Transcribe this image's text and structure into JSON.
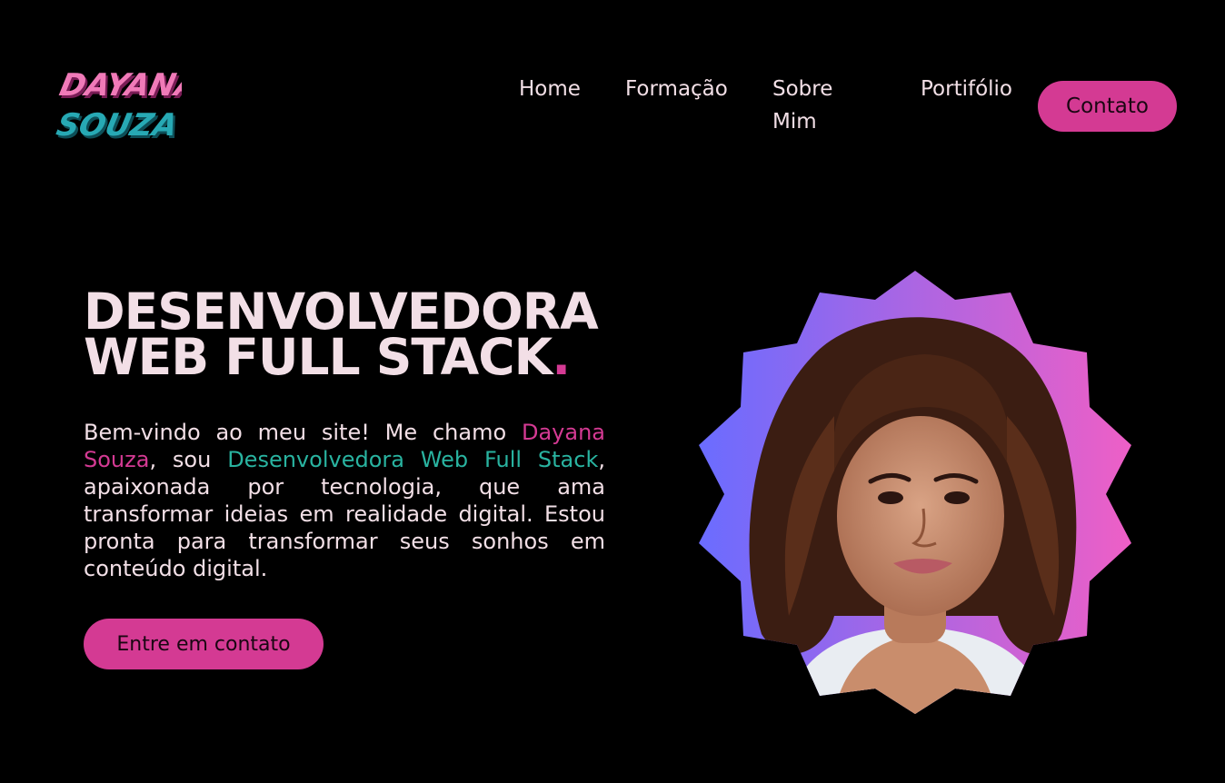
{
  "logo": {
    "line1": "DAYANA",
    "line2": "SOUZA",
    "colors": {
      "primary": "#f07ab8",
      "secondary": "#27a9b4",
      "shadow": "#7a1c56"
    }
  },
  "nav": {
    "items": [
      {
        "label": "Home"
      },
      {
        "label": "Formação"
      },
      {
        "label": "Sobre Mim"
      },
      {
        "label": "Portifólio"
      }
    ],
    "cta_label": "Contato"
  },
  "hero": {
    "title_line1": "DESENVOLVEDORA",
    "title_line2": "WEB FULL STACK",
    "title_dot": ".",
    "intro": {
      "part1": "Bem-vindo ao meu site! Me chamo ",
      "name": "Dayana Souza",
      "part2": ", sou ",
      "role": "Desenvolvedora Web Full Stack",
      "part3": ", apaixonada por tecnologia, que ama transformar ideias em realidade digital. Estou pronta para transformar seus sonhos em conteúdo digital."
    },
    "cta_label": "Entre em contato"
  },
  "portrait": {
    "icon": "profile-photo",
    "gradient": [
      "#6a6cff",
      "#ee5fc6"
    ]
  },
  "colors": {
    "background": "#000000",
    "text": "#f2dfe6",
    "accent_pink": "#d43a93",
    "accent_teal": "#29b3a0"
  }
}
